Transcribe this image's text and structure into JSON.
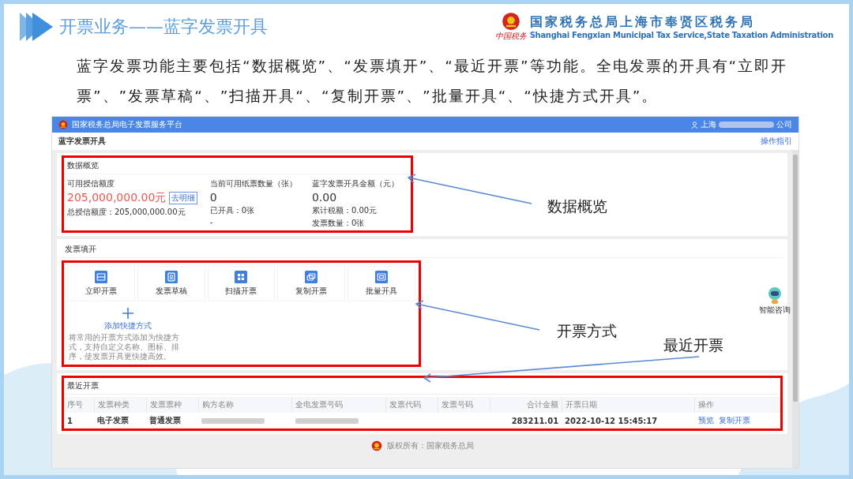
{
  "slide": {
    "title": "开票业务——蓝字发票开具",
    "org_name_cn": "国家税务总局上海市奉贤区税务局",
    "org_name_en": "Shanghai Fengxian Municipal Tax Service,State Taxation Administration",
    "org_seal_text": "中国税务"
  },
  "paragraph": "蓝字发票功能主要包括“数据概览”、“发票填开”、“最近开票”等功能。全电发票的开具有“立即开票”、”发票草稿“、”扫描开具“、“复制开票”、”批量开具“、“快捷方式开具”。",
  "screenshot": {
    "platform_title": "国家税务总局电子发票服务平台",
    "user_prefix": "上海",
    "user_suffix": "公司",
    "page_title": "蓝字发票开具",
    "guide_link": "操作指引",
    "overview": {
      "title": "数据概览",
      "stats": [
        {
          "kind": "credit",
          "label": "可用授信额度",
          "value": "205,000,000.00元",
          "badge": "去明细",
          "details": [
            "总授信额度：205,000,000.00元"
          ]
        },
        {
          "kind": "count",
          "label": "当前可用纸票数量（张）",
          "value": "0",
          "details": [
            "已开具：0张",
            "-"
          ]
        },
        {
          "kind": "amount",
          "label": "蓝字发票开具金额（元）",
          "value": "0.00",
          "details": [
            "累计税额：0.00元",
            "发票数量：0张"
          ]
        }
      ]
    },
    "issuing": {
      "title": "发票填开",
      "methods": [
        {
          "label": "立即开票"
        },
        {
          "label": "发票草稿"
        },
        {
          "label": "扫描开票"
        },
        {
          "label": "复制开票"
        },
        {
          "label": "批量开具"
        }
      ],
      "add_shortcut": {
        "label": "添加快捷方式",
        "description": "将常用的开票方式添加为快捷方式，支持自定义名称、图标、排序，使发票开具更快捷高效。"
      }
    },
    "recent": {
      "title": "最近开票",
      "columns": [
        "序号",
        "发票种类",
        "发票票种",
        "购方名称",
        "全电发票号码",
        "发票代码",
        "发票号码",
        "合计金额",
        "开票日期",
        "操作"
      ],
      "rows": [
        {
          "cells": [
            {
              "kind": "text",
              "text": "1"
            },
            {
              "kind": "text",
              "text": "电子发票"
            },
            {
              "kind": "text",
              "text": "普通发票"
            },
            {
              "kind": "redacted"
            },
            {
              "kind": "redacted"
            },
            {
              "kind": "empty"
            },
            {
              "kind": "empty"
            },
            {
              "kind": "amount",
              "text": "283211.01"
            },
            {
              "kind": "text",
              "text": "2022-10-12 15:45:17"
            },
            {
              "kind": "actions",
              "links": [
                "预览",
                "复制开票"
              ]
            }
          ]
        }
      ]
    },
    "footer": "版权所有：国家税务总局",
    "assistant_label": "智能咨询"
  },
  "annotations": [
    {
      "label": "数据概览"
    },
    {
      "label": "开票方式"
    },
    {
      "label": "最近开票"
    }
  ]
}
